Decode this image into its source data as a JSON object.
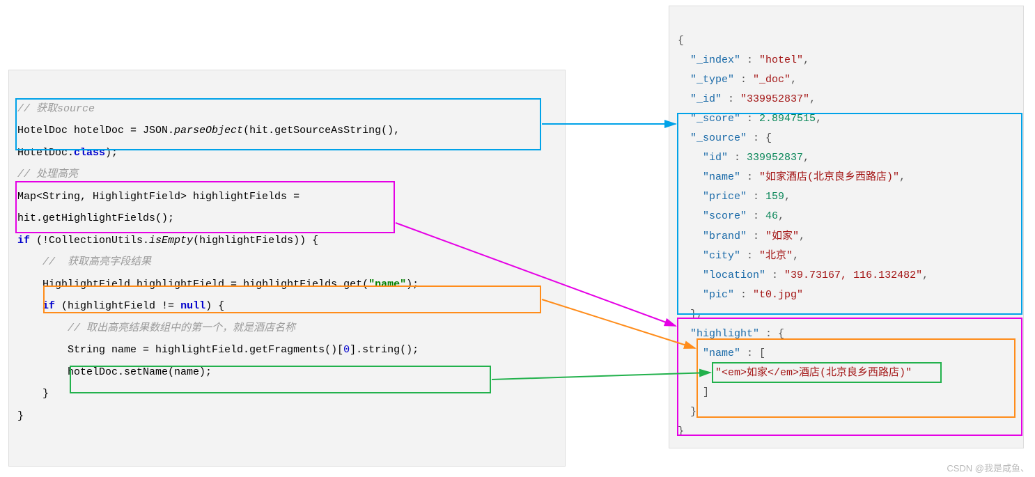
{
  "left": {
    "c1": "// 获取source",
    "l1": "HotelDoc hotelDoc = JSON.",
    "l1b": "parseObject",
    "l1c": "(hit.getSourceAsString(),",
    "l2a": "HotelDoc.",
    "l2b": "class",
    "l2c": ");",
    "c2": "// 处理高亮",
    "l3": "Map<String, HighlightField> highlightFields =",
    "l4": "hit.getHighlightFields();",
    "l5a": "if",
    "l5b": " (!CollectionUtils.",
    "l5c": "isEmpty",
    "l5d": "(highlightFields)) {",
    "c3": "//  获取高亮字段结果",
    "l6a": "HighlightField highlightField = highlightFields.get(",
    "l6b": "\"name\"",
    "l6c": ");",
    "l7a": "if",
    "l7b": " (highlightField != ",
    "l7c": "null",
    "l7d": ") {",
    "c4": "// 取出高亮结果数组中的第一个，就是酒店名称",
    "l8a": "String name = highlightField.getFragments()[",
    "l8b": "0",
    "l8c": "].string();",
    "l9": "hotelDoc.setName(name);",
    "l10": "}",
    "l11": "}"
  },
  "right": {
    "r0": "{",
    "k_index": "\"_index\"",
    "v_index": "\"hotel\"",
    "k_type": "\"_type\"",
    "v_type": "\"_doc\"",
    "k_id0": "\"_id\"",
    "v_id0": "\"339952837\"",
    "k_score0": "\"_score\"",
    "v_score0": "2.8947515",
    "k_source": "\"_source\"",
    "k_id": "\"id\"",
    "v_id": "339952837",
    "k_name": "\"name\"",
    "v_name": "\"如家酒店(北京良乡西路店)\"",
    "k_price": "\"price\"",
    "v_price": "159",
    "k_score": "\"score\"",
    "v_score": "46",
    "k_brand": "\"brand\"",
    "v_brand": "\"如家\"",
    "k_city": "\"city\"",
    "v_city": "\"北京\"",
    "k_loc": "\"location\"",
    "v_loc": "\"39.73167, 116.132482\"",
    "k_pic": "\"pic\"",
    "v_pic": "\"t0.jpg\"",
    "k_hl": "\"highlight\"",
    "k_nm": "\"name\"",
    "v_hl": "\"<em>如家</em>酒店(北京良乡西路店)\"",
    "rc": "}",
    "colon": " : ",
    "comma": ",",
    "lbrace": " : {",
    "lbrk": " : [",
    "rbrk": "]",
    "rbrace_c": "},"
  },
  "watermark": "CSDN @我是咸鱼、",
  "chart_data": {
    "type": "table",
    "note": "Diagram relating Java code regions to Elasticsearch JSON response fields",
    "mappings": [
      {
        "java": "HotelDoc hotelDoc = JSON.parseObject(hit.getSourceAsString(), HotelDoc.class);",
        "json_path": "_source",
        "color": "blue"
      },
      {
        "java": "Map<String, HighlightField> highlightFields = hit.getHighlightFields();",
        "json_path": "highlight",
        "color": "magenta"
      },
      {
        "java": "HighlightField highlightField = highlightFields.get(\"name\");",
        "json_path": "highlight.name",
        "color": "orange"
      },
      {
        "java": "String name = highlightField.getFragments()[0].string();",
        "json_path": "highlight.name[0]",
        "color": "green"
      }
    ],
    "json_response": {
      "_index": "hotel",
      "_type": "_doc",
      "_id": "339952837",
      "_score": 2.8947515,
      "_source": {
        "id": 339952837,
        "name": "如家酒店(北京良乡西路店)",
        "price": 159,
        "score": 46,
        "brand": "如家",
        "city": "北京",
        "location": "39.73167, 116.132482",
        "pic": "t0.jpg"
      },
      "highlight": {
        "name": [
          "<em>如家</em>酒店(北京良乡西路店)"
        ]
      }
    }
  }
}
